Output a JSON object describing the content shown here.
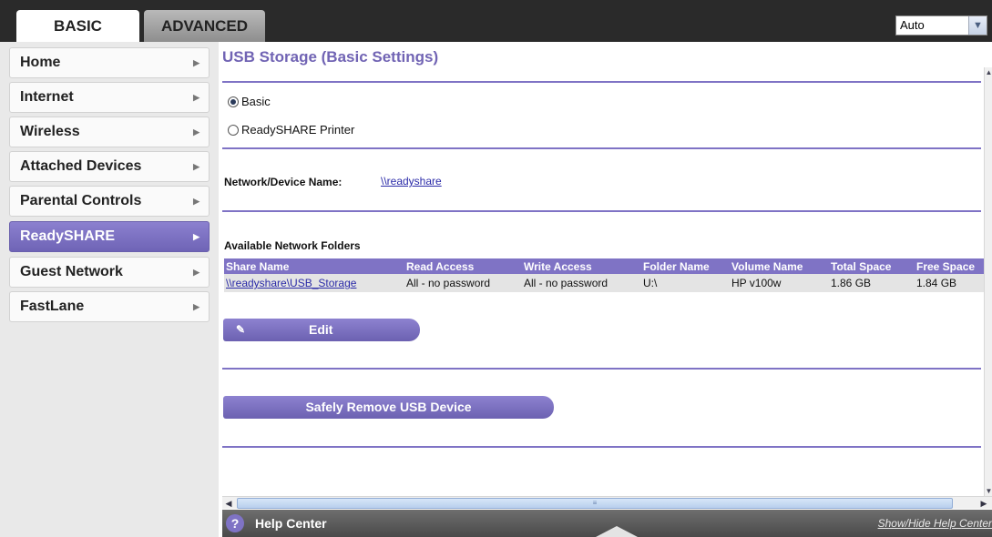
{
  "tabs": {
    "basic": "BASIC",
    "advanced": "ADVANCED"
  },
  "language_select": {
    "value": "Auto"
  },
  "sidebar": {
    "items": [
      {
        "label": "Home"
      },
      {
        "label": "Internet"
      },
      {
        "label": "Wireless"
      },
      {
        "label": "Attached Devices"
      },
      {
        "label": "Parental Controls"
      },
      {
        "label": "ReadySHARE",
        "active": true
      },
      {
        "label": "Guest Network"
      },
      {
        "label": "FastLane"
      }
    ]
  },
  "main": {
    "title": "USB Storage (Basic Settings)",
    "options": [
      {
        "label": "Basic",
        "checked": true
      },
      {
        "label": "ReadySHARE Printer",
        "checked": false
      }
    ],
    "device_name_label": "Network/Device Name:",
    "device_name_value": "\\\\readyshare",
    "folders_heading": "Available Network Folders",
    "table": {
      "headers": [
        "Share Name",
        "Read Access",
        "Write Access",
        "Folder Name",
        "Volume Name",
        "Total Space",
        "Free Space"
      ],
      "rows": [
        [
          "\\\\readyshare\\USB_Storage",
          "All - no password",
          "All - no password",
          "U:\\",
          "HP v100w",
          "1.86 GB",
          "1.84 GB"
        ]
      ]
    },
    "edit_button": "Edit",
    "safely_remove_button": "Safely Remove USB Device"
  },
  "help": {
    "label": "Help Center",
    "toggle": "Show/Hide Help Center"
  },
  "colors": {
    "accent": "#7f73c5",
    "topbar": "#2a2a2a",
    "sidebar_bg": "#e9e9e9"
  }
}
